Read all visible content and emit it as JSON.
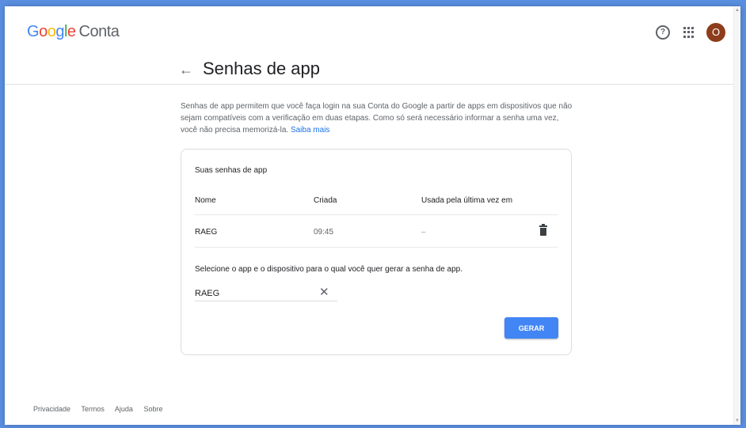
{
  "header": {
    "logo_google": [
      "G",
      "o",
      "o",
      "g",
      "l",
      "e"
    ],
    "logo_product": "Conta",
    "help_icon": "help-circle-icon",
    "apps_icon": "apps-grid-icon",
    "avatar_letter": "O",
    "avatar_color": "#8d3d1b"
  },
  "page": {
    "title": "Senhas de app",
    "back_icon": "arrow-back-icon",
    "description": "Senhas de app permitem que você faça login na sua Conta do Google a partir de apps em dispositivos que não sejam compatíveis com a verificação em duas etapas. Como só será necessário informar a senha uma vez, você não precisa memorizá-la.",
    "learn_more": "Saiba mais"
  },
  "card": {
    "title": "Suas senhas de app",
    "columns": [
      "Nome",
      "Criada",
      "Usada pela última vez em"
    ],
    "rows": [
      {
        "name": "RAEG",
        "created": "09:45",
        "last_used": "–",
        "delete_icon": "trash-icon"
      }
    ],
    "prompt": "Selecione o app e o dispositivo para o qual você quer gerar a senha de app.",
    "input_value": "RAEG",
    "clear_icon": "close-icon",
    "generate_label": "GERAR"
  },
  "footer": {
    "links": [
      "Privacidade",
      "Termos",
      "Ajuda",
      "Sobre"
    ]
  },
  "colors": {
    "accent": "#4285f4",
    "link": "#1a73e8"
  }
}
